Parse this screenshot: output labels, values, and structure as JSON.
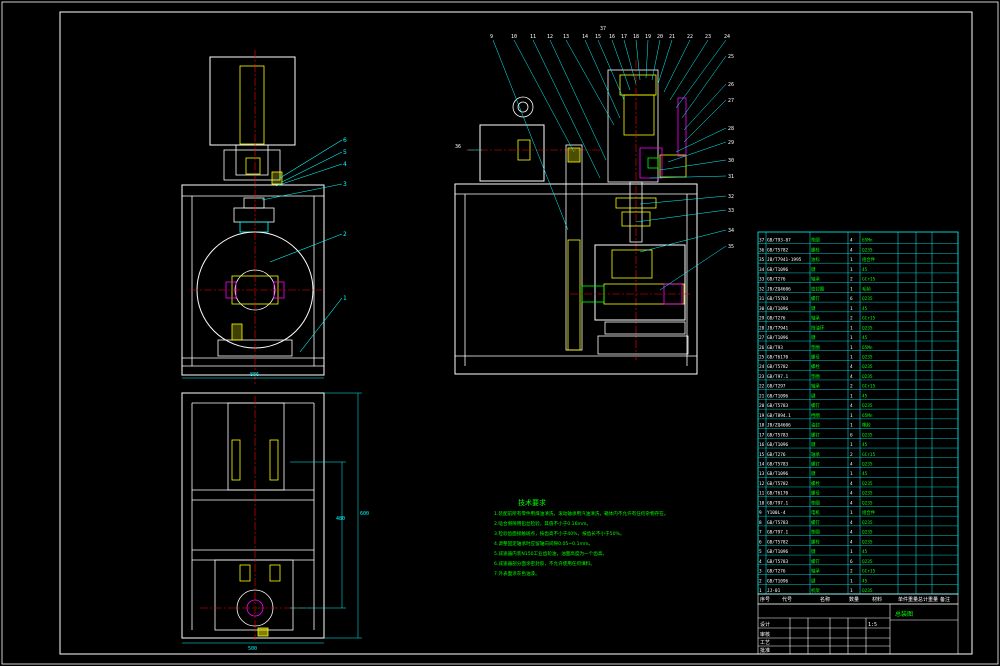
{
  "drawing": {
    "colors": {
      "background": "#000000",
      "frame": "#ffffff",
      "outline": "#ffffff",
      "centerline": "#ff0000",
      "leader": "#00ffff",
      "dimension": "#00ffff",
      "part_yellow": "#ffff00",
      "part_magenta": "#ff00ff",
      "part_green": "#00ff00",
      "text_green": "#00ff00",
      "table_line": "#00ffff"
    },
    "dims": {
      "front_height_text": "886",
      "top_width_text": "500",
      "plan_height_text": "600",
      "plan_inner_text": "480"
    },
    "technical_notes": {
      "title": "技术要求",
      "lines": [
        "1.装配前所有零件用煤油清洗，滚动轴承用汽油清洗，箱体内不允许有任何杂物存在。",
        "2.啮合侧隙用铅丝检验，其值不小于0.16mm。",
        "3.检验齿面接触斑点，按齿高不小于40%，按齿长不小于50%。",
        "4.调整固定轴承时应留轴向间隙0.05~0.1mm。",
        "5.减速器内装N150工业齿轮油，油面高度为一个齿高。",
        "6.减速器剖分面涂密封胶，不允许使用任何填料。",
        "7.外表面涂灰色油漆。"
      ]
    },
    "front_view_labels": [
      "1",
      "2",
      "3",
      "4",
      "5",
      "6"
    ],
    "section_view_labels": [
      "9",
      "10",
      "11",
      "12",
      "13",
      "14",
      "15",
      "16",
      "17",
      "18",
      "19",
      "20",
      "21",
      "22",
      "23",
      "24",
      "25",
      "26",
      "27",
      "28",
      "29",
      "30",
      "31",
      "32",
      "33",
      "34",
      "35",
      "36",
      "37"
    ],
    "title_block": {
      "header": [
        "序号",
        "代号",
        "名称",
        "数量",
        "材料",
        "单件重量",
        "总计重量",
        "备注"
      ],
      "drawing_name": "总装图",
      "scale": "1:5",
      "row_labels": [
        "设计",
        "审核",
        "工艺",
        "批准"
      ]
    },
    "parts_list": [
      [
        "37",
        "GB/T93-87",
        "垫圈",
        "4",
        "65Mn"
      ],
      [
        "36",
        "GB/T5782",
        "螺栓",
        "4",
        "Q235"
      ],
      [
        "35",
        "JB/T7941-1995",
        "油标",
        "1",
        "组合件"
      ],
      [
        "34",
        "GB/T1096",
        "键",
        "1",
        "45"
      ],
      [
        "33",
        "GB/T276",
        "轴承",
        "2",
        "GCr15"
      ],
      [
        "32",
        "JB/ZQ4606",
        "密封圈",
        "1",
        "毛毡"
      ],
      [
        "31",
        "GB/T5783",
        "螺钉",
        "6",
        "Q235"
      ],
      [
        "30",
        "GB/T1096",
        "键",
        "1",
        "45"
      ],
      [
        "29",
        "GB/T276",
        "轴承",
        "2",
        "GCr15"
      ],
      [
        "28",
        "JB/T7941",
        "挡油环",
        "1",
        "Q235"
      ],
      [
        "27",
        "GB/T1096",
        "键",
        "1",
        "45"
      ],
      [
        "26",
        "GB/T93",
        "垫圈",
        "1",
        "65Mn"
      ],
      [
        "25",
        "GB/T6170",
        "螺母",
        "1",
        "Q235"
      ],
      [
        "24",
        "GB/T5782",
        "螺栓",
        "4",
        "Q235"
      ],
      [
        "23",
        "GB/T97.1",
        "垫圈",
        "4",
        "Q235"
      ],
      [
        "22",
        "GB/T297",
        "轴承",
        "2",
        "GCr15"
      ],
      [
        "21",
        "GB/T1096",
        "键",
        "1",
        "45"
      ],
      [
        "20",
        "GB/T5783",
        "螺钉",
        "4",
        "Q235"
      ],
      [
        "19",
        "GB/T894.1",
        "挡圈",
        "1",
        "65Mn"
      ],
      [
        "18",
        "JB/ZQ4606",
        "油封",
        "1",
        "橡胶"
      ],
      [
        "17",
        "GB/T5783",
        "螺钉",
        "6",
        "Q235"
      ],
      [
        "16",
        "GB/T1096",
        "键",
        "1",
        "45"
      ],
      [
        "15",
        "GB/T276",
        "轴承",
        "2",
        "GCr15"
      ],
      [
        "14",
        "GB/T5783",
        "螺钉",
        "4",
        "Q235"
      ],
      [
        "13",
        "GB/T1096",
        "键",
        "1",
        "45"
      ],
      [
        "12",
        "GB/T5782",
        "螺栓",
        "4",
        "Q235"
      ],
      [
        "11",
        "GB/T6170",
        "螺母",
        "4",
        "Q235"
      ],
      [
        "10",
        "GB/T97.1",
        "垫圈",
        "4",
        "Q235"
      ],
      [
        "9",
        "Y100L-4",
        "电机",
        "1",
        "组合件"
      ],
      [
        "8",
        "GB/T5783",
        "螺钉",
        "4",
        "Q235"
      ],
      [
        "7",
        "GB/T97.1",
        "垫圈",
        "4",
        "Q235"
      ],
      [
        "6",
        "GB/T5782",
        "螺栓",
        "4",
        "Q235"
      ],
      [
        "5",
        "GB/T1096",
        "键",
        "1",
        "45"
      ],
      [
        "4",
        "GB/T5783",
        "螺钉",
        "6",
        "Q235"
      ],
      [
        "3",
        "GB/T276",
        "轴承",
        "2",
        "GCr15"
      ],
      [
        "2",
        "GB/T1096",
        "键",
        "1",
        "45"
      ],
      [
        "1",
        "JJ-01",
        "机架",
        "1",
        "Q235"
      ]
    ]
  }
}
